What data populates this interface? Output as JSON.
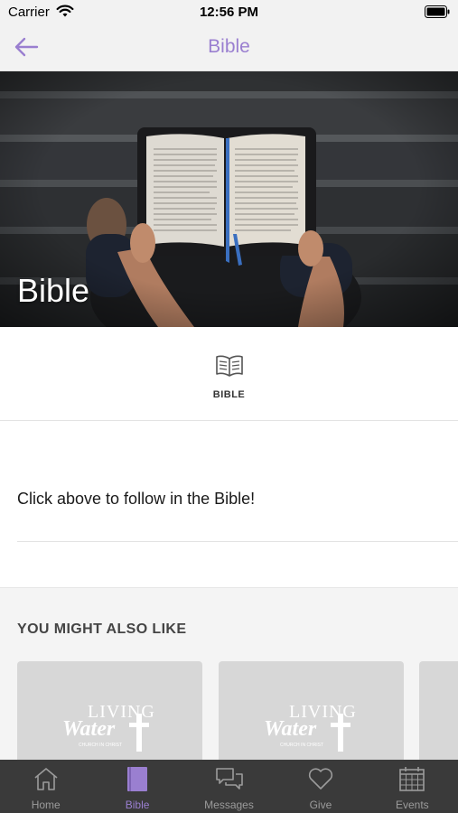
{
  "status_bar": {
    "carrier": "Carrier",
    "time": "12:56 PM"
  },
  "nav": {
    "title": "Bible",
    "back_icon": "arrow-left-icon"
  },
  "hero": {
    "title": "Bible",
    "image": "open-bible-held-in-hands-photo"
  },
  "bible_tab": {
    "label": "BIBLE",
    "icon": "open-book-icon"
  },
  "content": {
    "text": "Click above to follow in the Bible!"
  },
  "also_like": {
    "title": "YOU MIGHT ALSO LIKE",
    "cards": [
      {
        "logo_line1": "LIVING",
        "logo_line2": "Water",
        "logo_line3": "CHURCH IN CHRIST"
      },
      {
        "logo_line1": "LIVING",
        "logo_line2": "Water",
        "logo_line3": "CHURCH IN CHRIST"
      }
    ]
  },
  "tab_bar": {
    "tabs": [
      {
        "label": "Home",
        "icon": "home-icon",
        "active": false
      },
      {
        "label": "Bible",
        "icon": "bible-book-icon",
        "active": true
      },
      {
        "label": "Messages",
        "icon": "chat-bubbles-icon",
        "active": false
      },
      {
        "label": "Give",
        "icon": "heart-icon",
        "active": false
      },
      {
        "label": "Events",
        "icon": "calendar-icon",
        "active": false
      }
    ]
  },
  "colors": {
    "accent": "#9a7fd0",
    "tab_bar_bg": "#3a3a3a",
    "tab_inactive": "#9b9b9b",
    "bar_bg": "#f2f2f2"
  }
}
